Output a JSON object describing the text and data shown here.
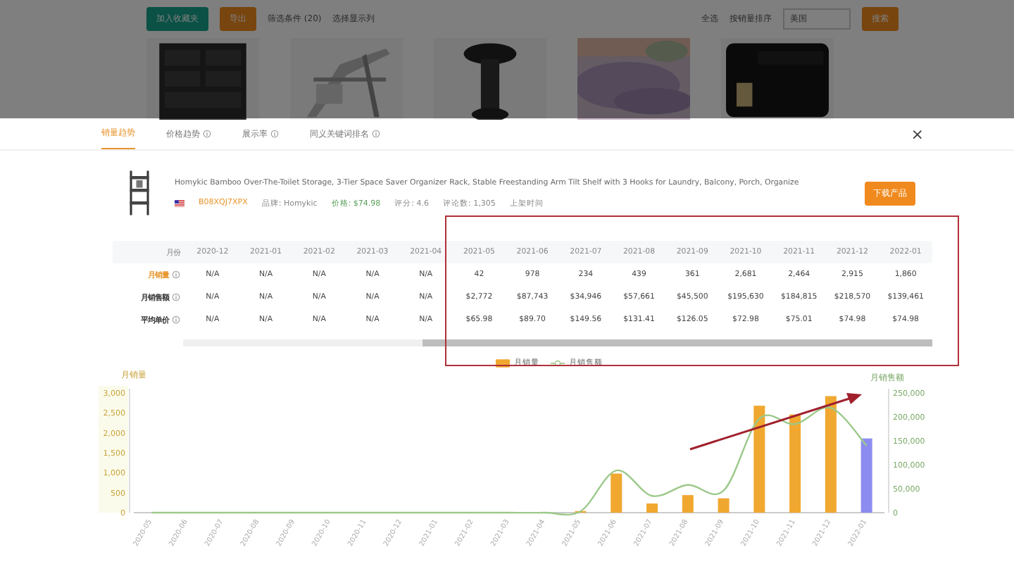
{
  "background_page": {
    "buttons": [
      {
        "label": "加入收藏夹",
        "kind": "primary"
      },
      {
        "label": "导出",
        "kind": "accent"
      }
    ],
    "links": [
      "筛选条件 (20)",
      "选择显示列"
    ],
    "right_items": [
      "全选",
      "按销量排序"
    ],
    "select": {
      "value": "美国"
    },
    "search_button": "搜索",
    "products": [
      {
        "kind": "picture"
      },
      {
        "kind": "picture"
      },
      {
        "kind": "picture"
      },
      {
        "kind": "picture"
      },
      {
        "kind": "picture"
      }
    ]
  },
  "modal": {
    "tabs": [
      {
        "label": "销量趋势",
        "selected": true,
        "info": false
      },
      {
        "label": "价格趋势",
        "selected": false,
        "info": true
      },
      {
        "label": "展示率",
        "selected": false,
        "info": true
      },
      {
        "label": "同义关键词排名",
        "selected": false,
        "info": true
      }
    ],
    "close": "×",
    "product": {
      "title": "Homykic Bamboo Over-The-Toilet Storage, 3-Tier Space Saver Organizer Rack, Stable Freestanding Arm Tilt Shelf with 3 Hooks for Laundry, Balcony, Porch, Organize",
      "asin": "B08XQJ7XPX",
      "meta": [
        "品牌: Homykic",
        "价格: $74.98",
        "评分: 4.6",
        "评论数: 1,305",
        "上架时间"
      ],
      "download": "下载产品"
    },
    "table": {
      "header": "月份",
      "columns": [
        "2020-12",
        "2021-01",
        "2021-02",
        "2021-03",
        "2021-04",
        "2021-05",
        "2021-06",
        "2021-07",
        "2021-08",
        "2021-09",
        "2021-10",
        "2021-11",
        "2021-12",
        "2022-01"
      ],
      "rows": [
        {
          "label": "月销量",
          "kind": "accent",
          "values": [
            "N/A",
            "N/A",
            "N/A",
            "N/A",
            "N/A",
            "42",
            "978",
            "234",
            "439",
            "361",
            "2,681",
            "2,464",
            "2,915",
            "1,860"
          ]
        },
        {
          "label": "月销售额",
          "kind": "plain",
          "values": [
            "N/A",
            "N/A",
            "N/A",
            "N/A",
            "N/A",
            "$2,772",
            "$87,743",
            "$34,946",
            "$57,661",
            "$45,500",
            "$195,630",
            "$184,815",
            "$218,570",
            "$139,461"
          ]
        },
        {
          "label": "平均单价",
          "kind": "plain",
          "values": [
            "N/A",
            "N/A",
            "N/A",
            "N/A",
            "N/A",
            "$65.98",
            "$89.70",
            "$149.56",
            "$131.41",
            "$126.05",
            "$72.98",
            "$75.01",
            "$74.98",
            "$74.98"
          ]
        }
      ]
    },
    "bar_chart": {
      "chart_data": {
        "type": "bar",
        "ylabel": "月销量",
        "categories": [
          "2020-05",
          "2020-06",
          "2020-07",
          "2020-08",
          "2020-09",
          "2020-10",
          "2020-11",
          "2020-12",
          "2021-01",
          "2021-02",
          "2021-03",
          "2021-04",
          "2021-05",
          "2021-06",
          "2021-07",
          "2021-08",
          "2021-09",
          "2021-10",
          "2021-11",
          "2021-12",
          "2022-01"
        ],
        "series": [
          {
            "name": "月销量",
            "color": "#f0a830",
            "values": [
              0,
              0,
              0,
              0,
              0,
              0,
              0,
              0,
              0,
              0,
              0,
              0,
              40,
              980,
              230,
              440,
              360,
              2680,
              2460,
              2920,
              null
            ]
          },
          {
            "color": "#8c8cf0",
            "values": [
              null,
              null,
              null,
              null,
              null,
              null,
              null,
              null,
              null,
              null,
              null,
              null,
              null,
              null,
              null,
              null,
              null,
              null,
              null,
              null,
              1860
            ]
          }
        ],
        "ylim": [
          0,
          3000
        ],
        "yticks": [
          {
            "value": 0,
            "label": "0"
          },
          {
            "value": 500,
            "label": "500"
          },
          {
            "value": 1000,
            "label": "1,000"
          },
          {
            "value": 1500,
            "label": "1,500"
          },
          {
            "value": 2000,
            "label": "2,000"
          },
          {
            "value": 2500,
            "label": "2,500"
          },
          {
            "value": 3000,
            "label": "3,000"
          }
        ]
      }
    },
    "line_chart": {
      "chart_data": {
        "type": "line",
        "ylabel": "月销售额",
        "series": [
          {
            "name": "月销售额",
            "color": "#9cc98a",
            "values": [
              0,
              0,
              0,
              0,
              0,
              0,
              0,
              0,
              0,
              0,
              0,
              0,
              3000,
              88000,
              35000,
              58000,
              46000,
              196000,
              185000,
              219000,
              140000
            ]
          }
        ],
        "ylim": [
          0,
          250000
        ],
        "yticks": [
          {
            "value": 0,
            "label": "0"
          },
          {
            "value": 50000,
            "label": "50,000"
          },
          {
            "value": 100000,
            "label": "100,000"
          },
          {
            "value": 150000,
            "label": "150,000"
          },
          {
            "value": 200000,
            "label": "200,000"
          },
          {
            "value": 250000,
            "label": "250,000"
          }
        ]
      }
    }
  }
}
